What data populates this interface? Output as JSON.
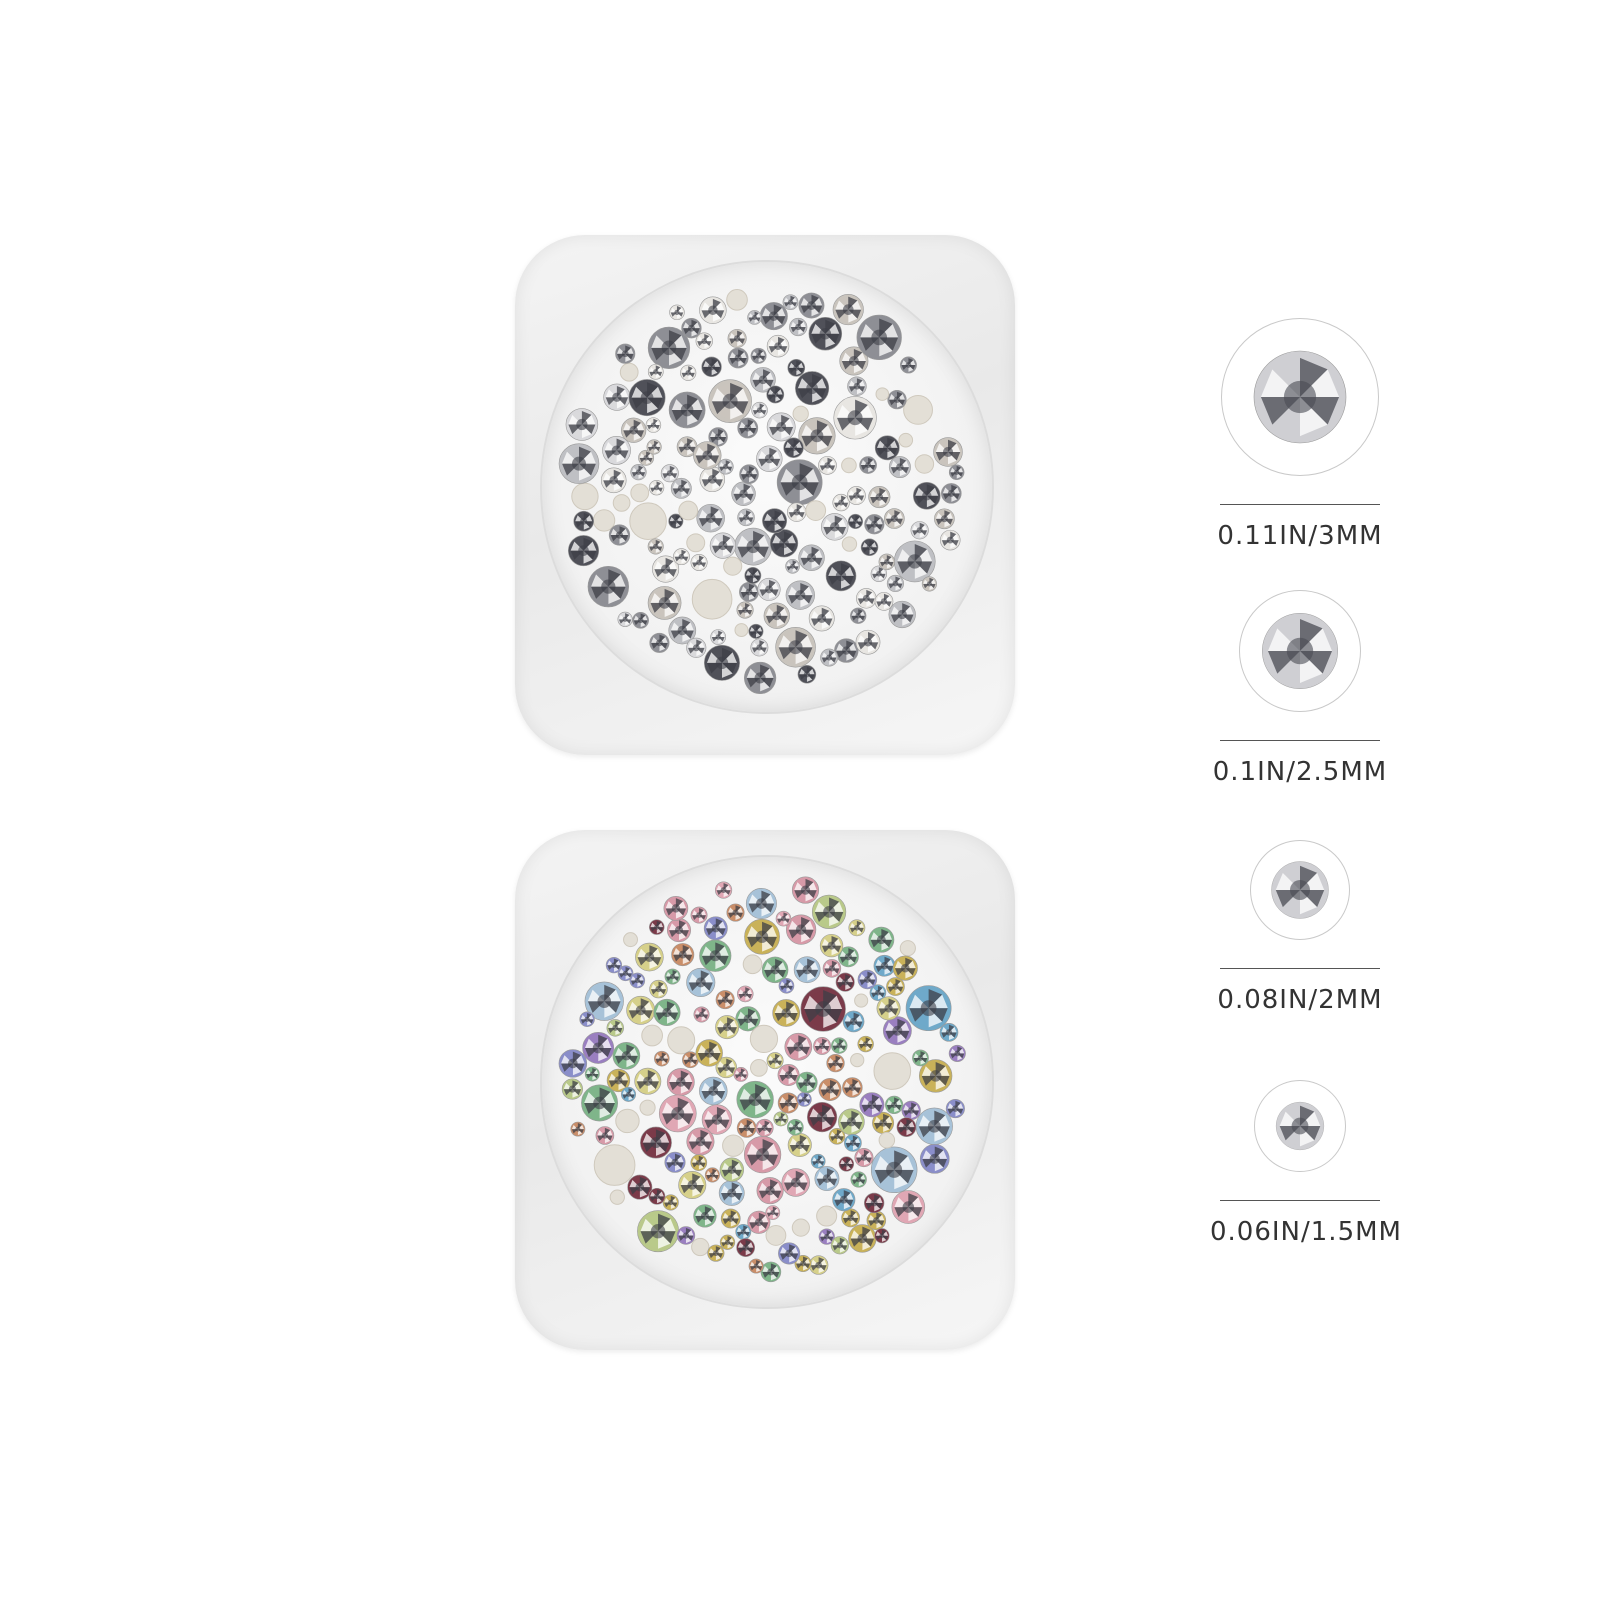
{
  "sizes": [
    {
      "label": "0.11IN/3MM"
    },
    {
      "label": "0.1IN/2.5MM"
    },
    {
      "label": "0.08IN/2MM"
    },
    {
      "label": "0.06IN/1.5MM"
    }
  ],
  "colors": {
    "clear_jar_gems": [
      "#d9d9dc",
      "#bfc0c4",
      "#8e8f95",
      "#505159",
      "#e8e6e2",
      "#c9c4bd"
    ],
    "color_jar_gems": [
      "#6fa9c9",
      "#7fb58a",
      "#d79aa8",
      "#c9b25a",
      "#8a8ec9",
      "#c98e6a",
      "#7b3b4a",
      "#b9c98a",
      "#9a7fc0",
      "#d6d08a",
      "#a7c2d8",
      "#e0a7b4"
    ]
  }
}
